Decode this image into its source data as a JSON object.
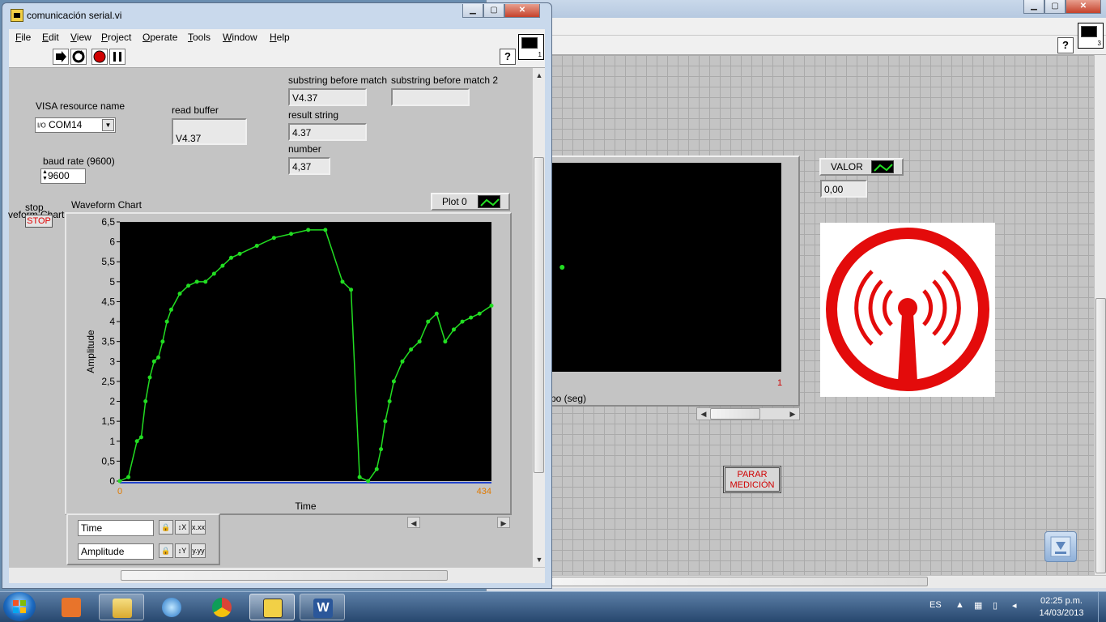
{
  "bg_window": {
    "help_label": "?",
    "icon_number": "3",
    "chart_x_label_partial": "po  (seg)",
    "chart_x_max": "1",
    "valor": {
      "label": "VALOR",
      "value": "0,00"
    },
    "parar_button": {
      "line1": "PARAR",
      "line2": "MEDICIÓN"
    }
  },
  "main_window": {
    "title": "comunicación serial.vi",
    "min_label": "▁",
    "max_label": "▢",
    "close_label": "✕",
    "help_label": "?",
    "icon_number": "1",
    "menu": [
      "File",
      "Edit",
      "View",
      "Project",
      "Operate",
      "Tools",
      "Window",
      "Help"
    ]
  },
  "front_panel": {
    "visa": {
      "label": "VISA resource name",
      "prefix": "I/O",
      "value": "COM14"
    },
    "baud": {
      "label": "baud rate (9600)",
      "value": "9600"
    },
    "read_buffer": {
      "label": "read buffer",
      "value": "V4.37"
    },
    "substring_before": {
      "label": "substring before match",
      "value": "V4.37"
    },
    "substring_before2": {
      "label": "substring before match 2",
      "value": ""
    },
    "result_string": {
      "label": "result string",
      "value": "4.37"
    },
    "number": {
      "label": "number",
      "value": "4,37"
    },
    "stop": {
      "label": "stop",
      "button": "STOP",
      "overlap_text": "veform Chart"
    },
    "x_scale_name": "Time",
    "y_scale_name": "Amplitude"
  },
  "chart_data": {
    "type": "line",
    "title": "Waveform Chart",
    "xlabel": "Time",
    "ylabel": "Amplitude",
    "xlim": [
      0,
      434
    ],
    "ylim": [
      0,
      6.5
    ],
    "x_tick_labels": [
      "0",
      "434"
    ],
    "y_tick_labels": [
      "6,5",
      "6",
      "5,5",
      "5",
      "4,5",
      "4",
      "3,5",
      "3",
      "2,5",
      "2",
      "1,5",
      "1",
      "0,5",
      "0"
    ],
    "legend": [
      "Plot 0"
    ],
    "color": "#22dd22",
    "series": [
      {
        "name": "Plot 0",
        "x": [
          0,
          10,
          20,
          25,
          30,
          35,
          40,
          45,
          50,
          55,
          60,
          70,
          80,
          90,
          100,
          110,
          120,
          130,
          140,
          160,
          180,
          200,
          220,
          240,
          260,
          270,
          280,
          290,
          300,
          305,
          310,
          315,
          320,
          330,
          340,
          350,
          360,
          370,
          380,
          390,
          400,
          410,
          420,
          434
        ],
        "values": [
          0,
          0.1,
          1.0,
          1.1,
          2.0,
          2.6,
          3.0,
          3.1,
          3.5,
          4.0,
          4.3,
          4.7,
          4.9,
          5.0,
          5.0,
          5.2,
          5.4,
          5.6,
          5.7,
          5.9,
          6.1,
          6.2,
          6.3,
          6.3,
          5.0,
          4.8,
          0.1,
          0,
          0.3,
          0.8,
          1.5,
          2.0,
          2.5,
          3.0,
          3.3,
          3.5,
          4.0,
          4.2,
          3.5,
          3.8,
          4.0,
          4.1,
          4.2,
          4.4
        ]
      }
    ]
  },
  "xy_graph_data": {
    "type": "scatter",
    "points": [
      {
        "x": 0.05,
        "y": 0.5
      }
    ]
  },
  "taskbar": {
    "apps": [
      "windows-media-center",
      "file-explorer",
      "media-player",
      "chrome",
      "labview",
      "word"
    ],
    "language": "ES",
    "time": "02:25 p.m.",
    "date": "14/03/2013"
  }
}
